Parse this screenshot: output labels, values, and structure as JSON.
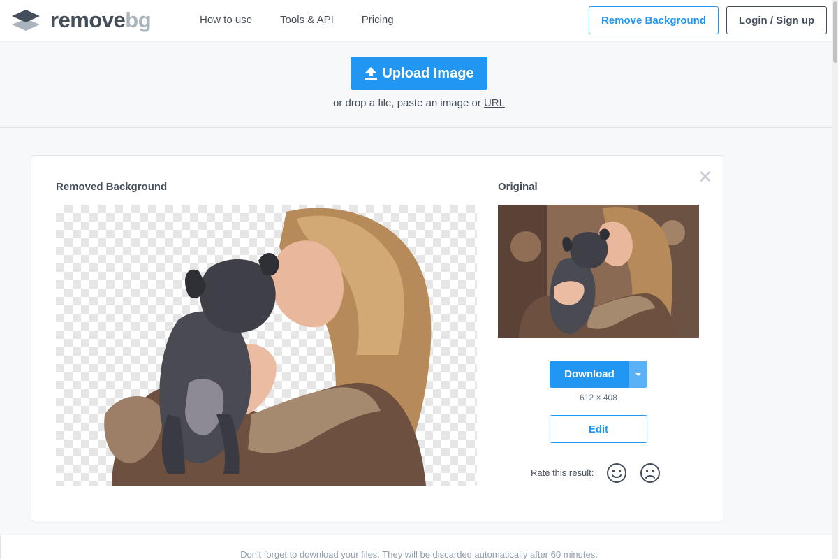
{
  "brand": {
    "word_main": "remove",
    "word_accent": "bg",
    "logo_icon": "stacked-layers-logo",
    "colors": {
      "dark": "#454f5b",
      "accent": "#aab4bd",
      "primary": "#2196f3"
    }
  },
  "nav": {
    "items": [
      {
        "label": "How to use"
      },
      {
        "label": "Tools & API"
      },
      {
        "label": "Pricing"
      }
    ]
  },
  "header_actions": {
    "remove_background": "Remove Background",
    "login": "Login / Sign up"
  },
  "upload": {
    "button_label": "Upload Image",
    "button_icon": "upload-arrow-icon",
    "hint_prefix": "or drop a file, paste an image or",
    "hint_link": "URL"
  },
  "result": {
    "close_symbol": "✕",
    "removed_title": "Removed Background",
    "original_title": "Original",
    "download_label": "Download",
    "dropdown_icon": "caret-down-icon",
    "dimensions": "612 × 408",
    "edit_label": "Edit",
    "rate_label": "Rate this result:",
    "rate_icons": [
      "happy-face-icon",
      "sad-face-icon"
    ]
  },
  "footer": {
    "note": "Don't forget to download your files. They will be discarded automatically after 60 minutes."
  }
}
